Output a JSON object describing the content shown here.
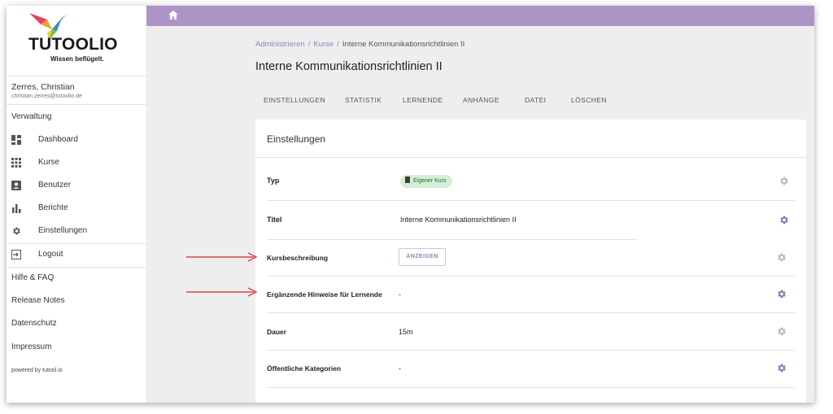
{
  "brand": {
    "name": "TUTOOLIO",
    "tagline": "Wissen beflügelt."
  },
  "user": {
    "name": "Zerres, Christian",
    "email": "christian.zerres@tutoolio.de"
  },
  "sidebar": {
    "section_label": "Verwaltung",
    "items": [
      {
        "label": "Dashboard",
        "icon": "dashboard-icon"
      },
      {
        "label": "Kurse",
        "icon": "grid-icon"
      },
      {
        "label": "Benutzer",
        "icon": "person-icon"
      },
      {
        "label": "Berichte",
        "icon": "bar-chart-icon"
      },
      {
        "label": "Einstellungen",
        "icon": "gear-icon"
      }
    ],
    "logout_label": "Logout",
    "links": [
      "Hilfe & FAQ",
      "Release Notes",
      "Datenschutz",
      "Impressum"
    ],
    "powered_by": "powered by tutool.io"
  },
  "breadcrumb": {
    "items": [
      "Administrieren",
      "Kurse",
      "Interne Kommunikationsrichtlinien II"
    ],
    "separator": "/"
  },
  "page_title": "Interne Kommunikationsrichtlinien II",
  "tabs": [
    "EINSTELLUNGEN",
    "STATISTIK",
    "LERNENDE",
    "ANHÄNGE",
    "DATEI",
    "LÖSCHEN"
  ],
  "settings": {
    "heading": "Einstellungen",
    "rows": [
      {
        "label": "Typ",
        "value": "Eigener Kurs"
      },
      {
        "label": "Titel",
        "value": "Interne Kommunikationsrichtlinien II"
      },
      {
        "label": "Kursbeschreibung",
        "button": "ANZEIGEN"
      },
      {
        "label": "Ergänzende Hinweise für Lernende",
        "value": "-"
      },
      {
        "label": "Dauer",
        "value": "15m"
      },
      {
        "label": "Öffentliche Kategorien",
        "value": "-"
      }
    ]
  },
  "colors": {
    "topbar": "#ad94c6",
    "accent": "#9a80b8",
    "chip_bg": "#d4edd6",
    "arrow": "#e02020",
    "gear_active": "#8e6bb0",
    "gear_inactive": "#b5b5b5"
  }
}
